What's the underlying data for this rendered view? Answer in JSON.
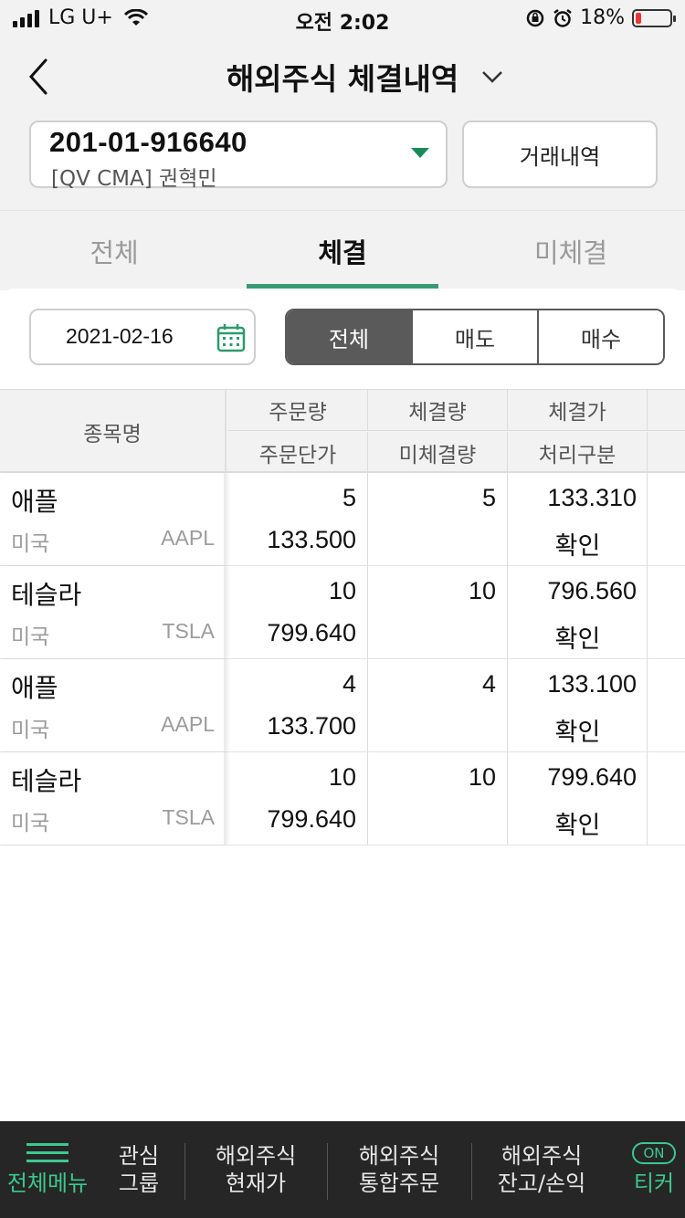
{
  "status_bar": {
    "carrier": "LG U+",
    "time": "오전 2:02",
    "battery": "18%",
    "battery_level": 0.18
  },
  "header": {
    "title": "해외주식 체결내역"
  },
  "account": {
    "number": "201-01-916640",
    "name": "[QV CMA]  권혁민",
    "history_button": "거래내역"
  },
  "tabs": [
    {
      "label": "전체",
      "active": false
    },
    {
      "label": "체결",
      "active": true
    },
    {
      "label": "미체결",
      "active": false
    }
  ],
  "filter": {
    "date": "2021-02-16",
    "segments": [
      {
        "label": "전체",
        "active": true
      },
      {
        "label": "매도",
        "active": false
      },
      {
        "label": "매수",
        "active": false
      }
    ]
  },
  "table": {
    "headers": {
      "name": "종목명",
      "row1": [
        "주문량",
        "체결량",
        "체결가"
      ],
      "row2": [
        "주문단가",
        "미체결량",
        "처리구분"
      ]
    },
    "rows": [
      {
        "name": "애플",
        "country": "미국",
        "ticker": "AAPL",
        "order_qty": "5",
        "order_price": "133.500",
        "filled_qty": "5",
        "unfilled_qty": "",
        "filled_price": "133.310",
        "status": "확인"
      },
      {
        "name": "테슬라",
        "country": "미국",
        "ticker": "TSLA",
        "order_qty": "10",
        "order_price": "799.640",
        "filled_qty": "10",
        "unfilled_qty": "",
        "filled_price": "796.560",
        "status": "확인"
      },
      {
        "name": "애플",
        "country": "미국",
        "ticker": "AAPL",
        "order_qty": "4",
        "order_price": "133.700",
        "filled_qty": "4",
        "unfilled_qty": "",
        "filled_price": "133.100",
        "status": "확인"
      },
      {
        "name": "테슬라",
        "country": "미국",
        "ticker": "TSLA",
        "order_qty": "10",
        "order_price": "799.640",
        "filled_qty": "10",
        "unfilled_qty": "",
        "filled_price": "799.640",
        "status": "확인"
      }
    ]
  },
  "tabbar": {
    "menu": "전체메뉴",
    "items": [
      {
        "line1": "관심",
        "line2": "그룹"
      },
      {
        "line1": "해외주식",
        "line2": "현재가"
      },
      {
        "line1": "해외주식",
        "line2": "통합주문"
      },
      {
        "line1": "해외주식",
        "line2": "잔고/손익"
      }
    ],
    "ticker_toggle": "ON",
    "ticker": "티커"
  },
  "colors": {
    "accent_green": "#3a9a74",
    "caret_green": "#1b8a5a",
    "tabbar_bg": "#262626",
    "segment_active": "#5a5a5a",
    "battery_low": "#e53935"
  }
}
